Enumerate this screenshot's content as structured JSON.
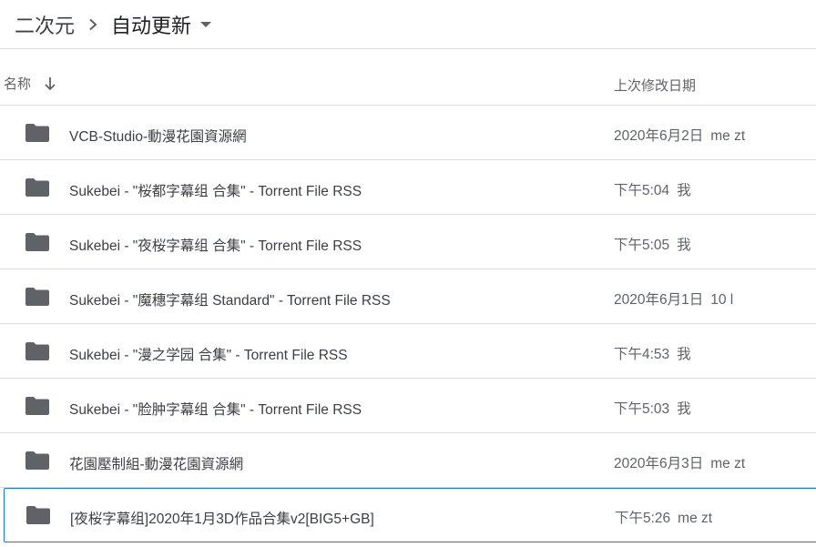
{
  "breadcrumb": {
    "root": "二次元",
    "current": "自动更新"
  },
  "columns": {
    "name": "名称",
    "modified": "上次修改日期"
  },
  "files": [
    {
      "name": "VCB-Studio-動漫花園資源網",
      "modified": "2020年6月2日",
      "owner": "me zt"
    },
    {
      "name": "Sukebei - \"桜都字幕组 合集\" - Torrent File RSS",
      "modified": "下午5:04",
      "owner": "我"
    },
    {
      "name": "Sukebei - \"夜桜字幕组 合集\" - Torrent File RSS",
      "modified": "下午5:05",
      "owner": "我"
    },
    {
      "name": "Sukebei - \"魔穗字幕组 Standard\" - Torrent File RSS",
      "modified": "2020年6月1日",
      "owner": "10 l"
    },
    {
      "name": "Sukebei - \"漫之学园 合集\" - Torrent File RSS",
      "modified": "下午4:53",
      "owner": "我"
    },
    {
      "name": "Sukebei - \"脸肿字幕组 合集\" - Torrent File RSS",
      "modified": "下午5:03",
      "owner": "我"
    },
    {
      "name": "花園壓制組-動漫花園資源網",
      "modified": "2020年6月3日",
      "owner": "me zt"
    },
    {
      "name": "[夜桜字幕组]2020年1月3D作品合集v2[BIG5+GB]",
      "modified": "下午5:26",
      "owner": "me zt"
    }
  ],
  "colors": {
    "folder": "#5f6368",
    "selection_border": "#1a73e8",
    "divider": "#dadce0"
  },
  "icons": [
    "chevron-right-icon",
    "caret-down-icon",
    "arrow-down-icon",
    "folder-icon"
  ]
}
